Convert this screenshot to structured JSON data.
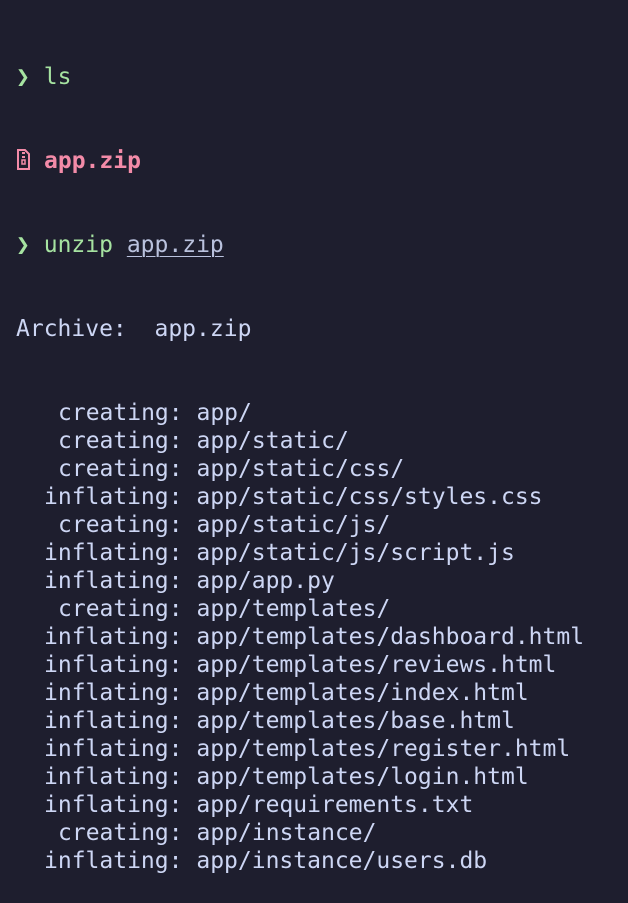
{
  "colors": {
    "background": "#1e1e2e",
    "prompt": "#a6e3a1",
    "zip_file": "#f38ba8",
    "text": "#cdd6f4"
  },
  "lines": {
    "cmd1": {
      "prompt": "❯",
      "command": "ls"
    },
    "listing": {
      "icon": "zip-file-icon",
      "filename": "app.zip"
    },
    "cmd2": {
      "prompt": "❯",
      "command": "unzip",
      "argument": "app.zip"
    },
    "archive": {
      "label": "Archive:",
      "file": "app.zip"
    },
    "entries": [
      {
        "action": "creating:",
        "path": "app/"
      },
      {
        "action": "creating:",
        "path": "app/static/"
      },
      {
        "action": "creating:",
        "path": "app/static/css/"
      },
      {
        "action": "inflating:",
        "path": "app/static/css/styles.css"
      },
      {
        "action": "creating:",
        "path": "app/static/js/"
      },
      {
        "action": "inflating:",
        "path": "app/static/js/script.js"
      },
      {
        "action": "inflating:",
        "path": "app/app.py"
      },
      {
        "action": "creating:",
        "path": "app/templates/"
      },
      {
        "action": "inflating:",
        "path": "app/templates/dashboard.html"
      },
      {
        "action": "inflating:",
        "path": "app/templates/reviews.html"
      },
      {
        "action": "inflating:",
        "path": "app/templates/index.html"
      },
      {
        "action": "inflating:",
        "path": "app/templates/base.html"
      },
      {
        "action": "inflating:",
        "path": "app/templates/register.html"
      },
      {
        "action": "inflating:",
        "path": "app/templates/login.html"
      },
      {
        "action": "inflating:",
        "path": "app/requirements.txt"
      },
      {
        "action": "creating:",
        "path": "app/instance/"
      },
      {
        "action": "inflating:",
        "path": "app/instance/users.db"
      }
    ]
  }
}
